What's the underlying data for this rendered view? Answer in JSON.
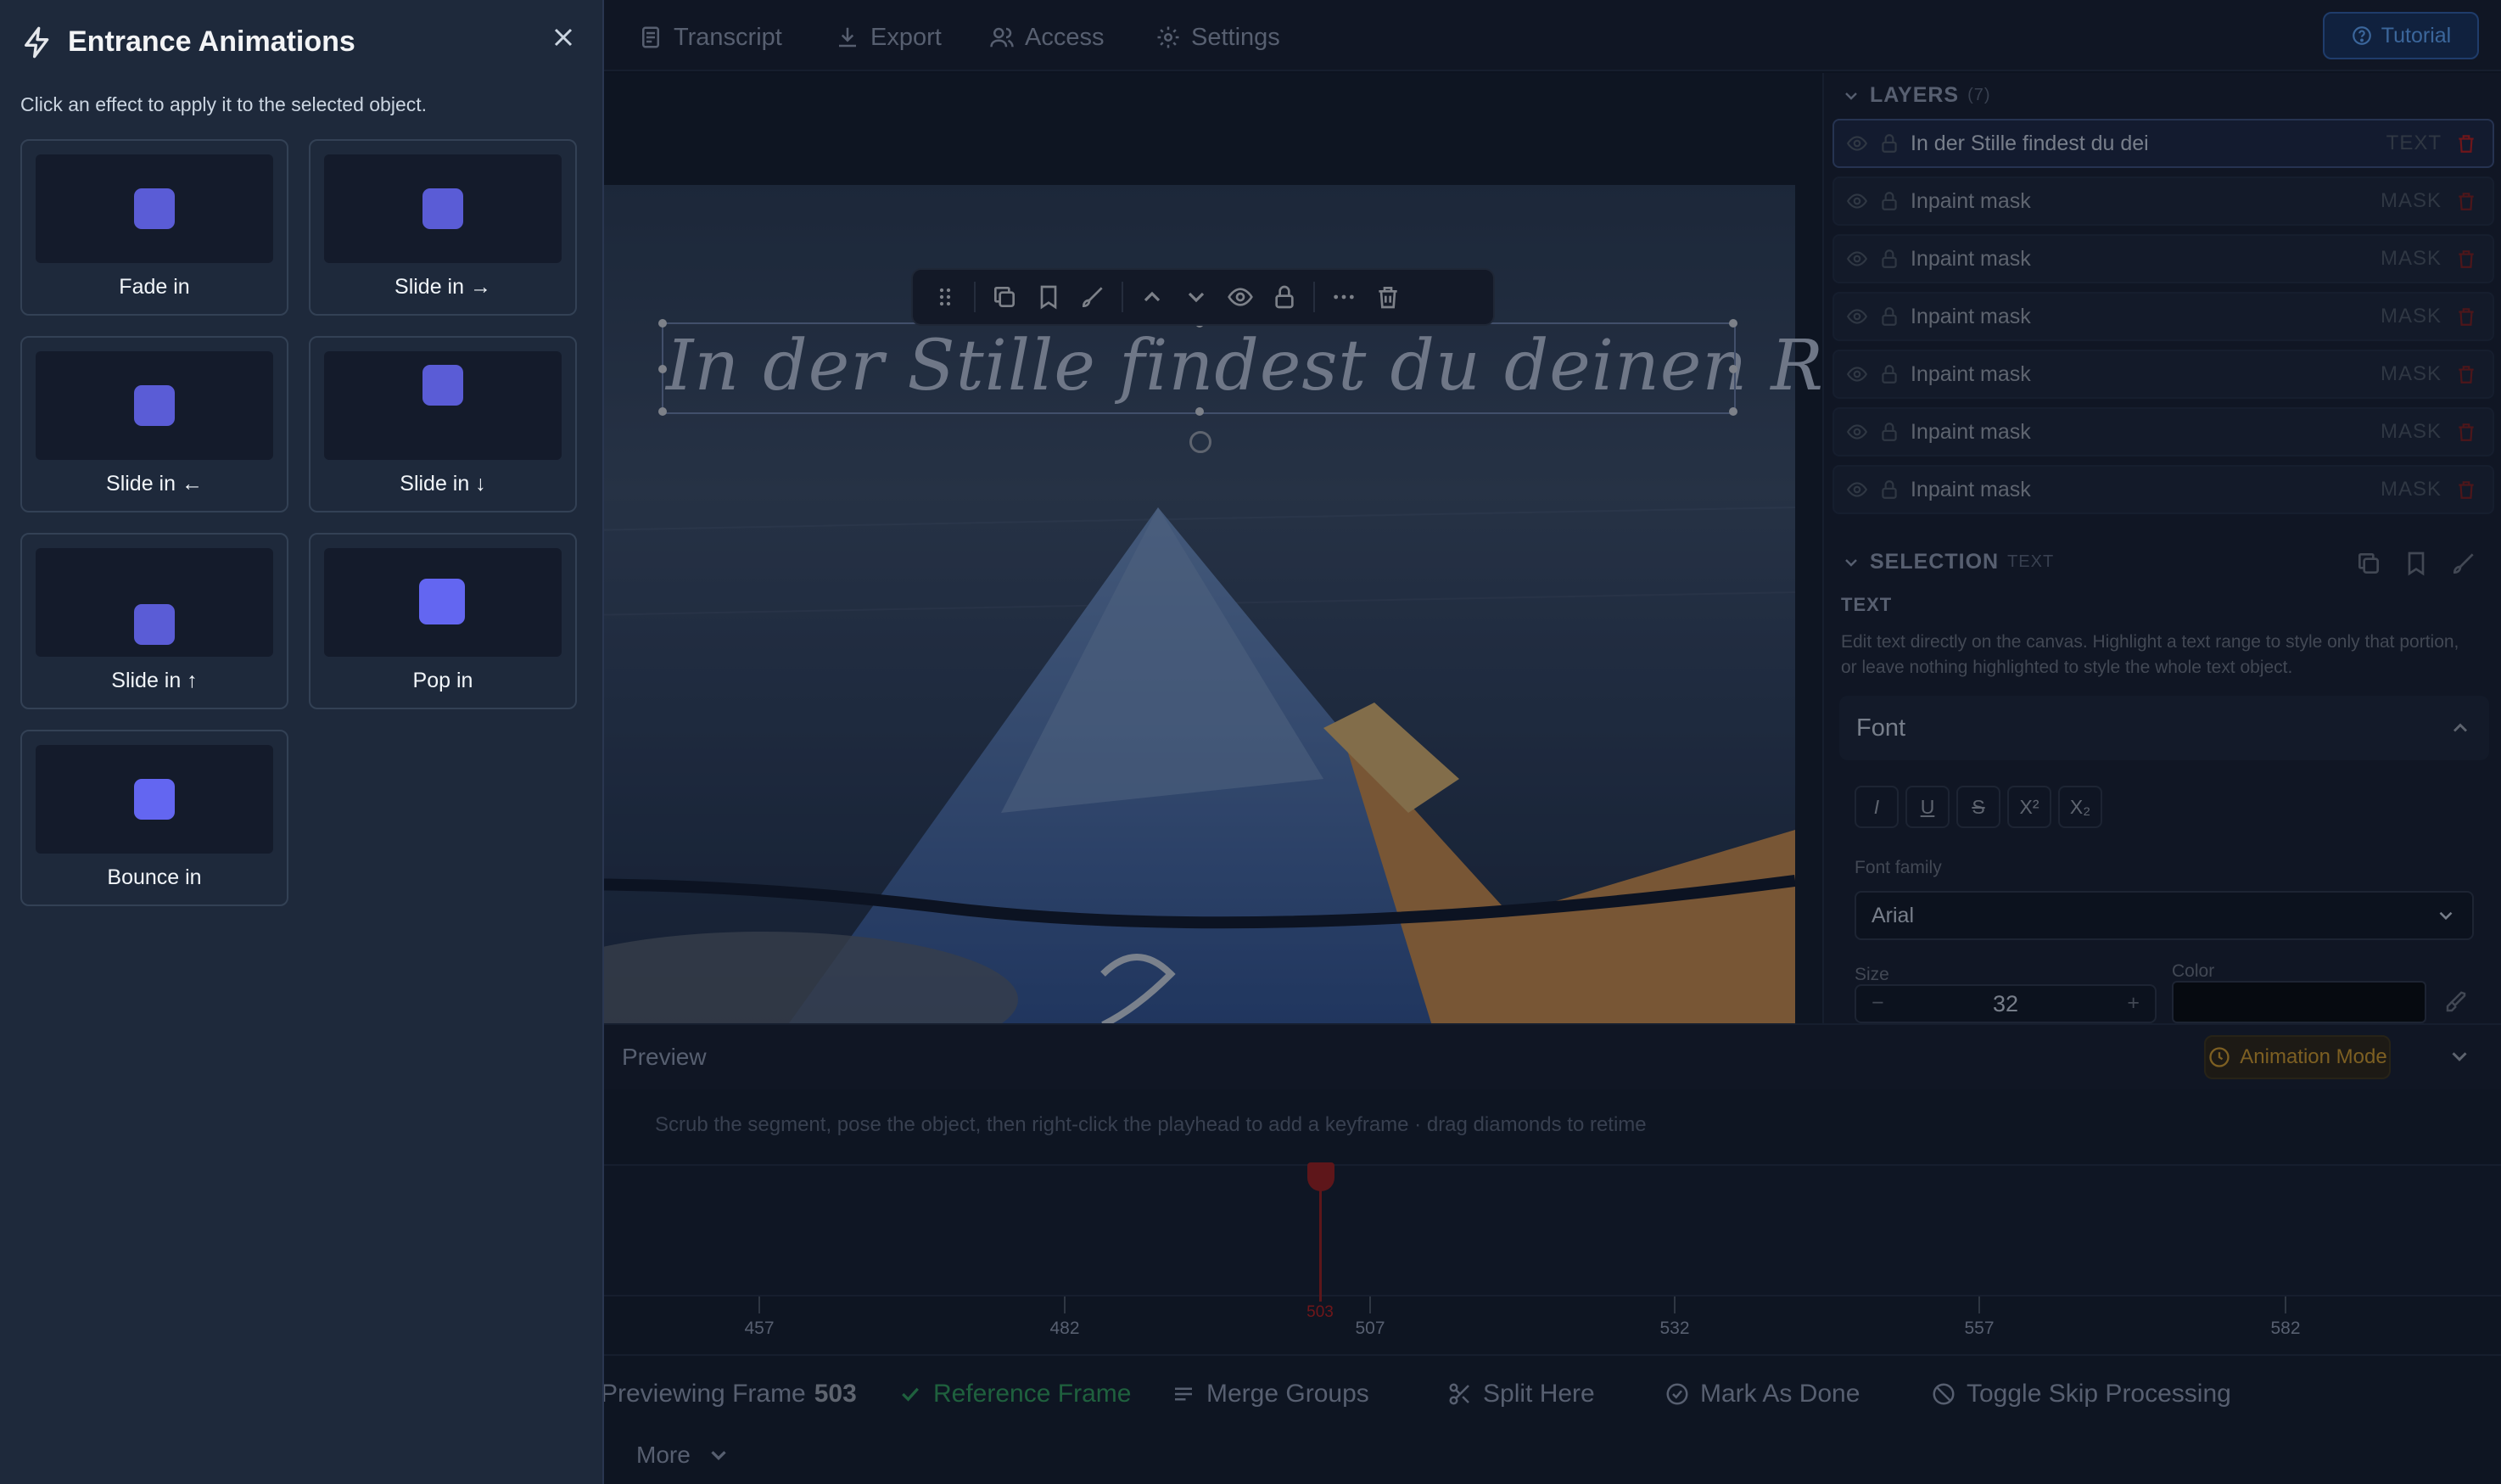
{
  "topbar": {
    "tabs": [
      {
        "label": "Transcript",
        "icon": "transcript-icon"
      },
      {
        "label": "Export",
        "icon": "download-icon"
      },
      {
        "label": "Access",
        "icon": "users-icon"
      },
      {
        "label": "Settings",
        "icon": "gear-icon"
      }
    ],
    "tutorial_label": "Tutorial"
  },
  "canvas": {
    "overlay_text": "In der Stille findest du deinen Rhythmus."
  },
  "layers": {
    "title": "LAYERS",
    "count": "(7)",
    "items": [
      {
        "name": "In der Stille findest du dei",
        "type": "TEXT"
      },
      {
        "name": "Inpaint mask",
        "type": "MASK"
      },
      {
        "name": "Inpaint mask",
        "type": "MASK"
      },
      {
        "name": "Inpaint mask",
        "type": "MASK"
      },
      {
        "name": "Inpaint mask",
        "type": "MASK"
      },
      {
        "name": "Inpaint mask",
        "type": "MASK"
      },
      {
        "name": "Inpaint mask",
        "type": "MASK"
      }
    ]
  },
  "selection": {
    "title": "SELECTION",
    "type_badge": "TEXT",
    "section_label": "TEXT",
    "help_line1": "Edit text directly on the canvas. Highlight a text range to style only that portion,",
    "help_line2": "or leave nothing highlighted to style the whole text object.",
    "font_header": "Font",
    "format_buttons": [
      "I",
      "U",
      "S",
      "X²",
      "X₂"
    ],
    "font_family_label": "Font family",
    "font_family_value": "Arial",
    "size_label": "Size",
    "size_value": "32",
    "size_minus": "−",
    "size_plus": "+",
    "color_label": "Color"
  },
  "timeline": {
    "preview_label": "Preview",
    "animation_mode_label": "Animation Mode",
    "hint": "Scrub the segment, pose the object, then right-click the playhead to add a keyframe · drag diamonds to retime",
    "playhead_frame": "503",
    "ticks": [
      "457",
      "482",
      "507",
      "532",
      "557",
      "582"
    ],
    "previewing_prefix": "Previewing Frame",
    "previewing_frame": "503",
    "actions": [
      "Reference Frame",
      "Merge Groups",
      "Split Here",
      "Mark As Done",
      "Toggle Skip Processing"
    ],
    "more_label": "More"
  },
  "panel": {
    "title": "Entrance Animations",
    "description": "Click an effect to apply it to the selected object.",
    "effects": [
      {
        "label": "Fade in"
      },
      {
        "label": "Slide in →"
      },
      {
        "label": "Slide in ←"
      },
      {
        "label": "Slide in ↓"
      },
      {
        "label": "Slide in ↑"
      },
      {
        "label": "Pop in"
      },
      {
        "label": "Bounce in"
      }
    ]
  },
  "colors": {
    "accent": "#5a5cd6",
    "tutorial": "#60a5fa",
    "playhead": "#9b1c1c",
    "animation_mode": "#d19a2a",
    "reference_frame": "#2f9e5a"
  }
}
